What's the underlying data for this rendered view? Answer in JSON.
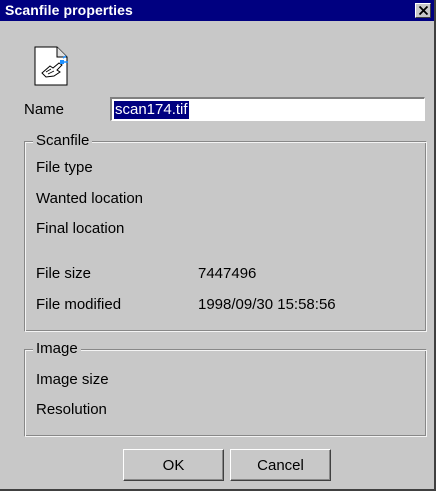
{
  "window": {
    "title": "Scanfile properties"
  },
  "icon": {
    "name": "document-properties-icon"
  },
  "name_field": {
    "label": "Name",
    "value": "scan174.tif"
  },
  "scanfile_group": {
    "legend": "Scanfile",
    "fields": [
      {
        "label": "File type",
        "value": ""
      },
      {
        "label": "Wanted location",
        "value": ""
      },
      {
        "label": "Final location",
        "value": ""
      },
      {
        "label": "File size",
        "value": "7447496"
      },
      {
        "label": "File modified",
        "value": "1998/09/30 15:58:56"
      }
    ]
  },
  "image_group": {
    "legend": "Image",
    "fields": [
      {
        "label": "Image size",
        "value": ""
      },
      {
        "label": "Resolution",
        "value": ""
      }
    ]
  },
  "buttons": {
    "ok": "OK",
    "cancel": "Cancel"
  },
  "colors": {
    "titlebar": "#000080",
    "dialog_bg": "#c8c8c8",
    "selection": "#000080"
  }
}
